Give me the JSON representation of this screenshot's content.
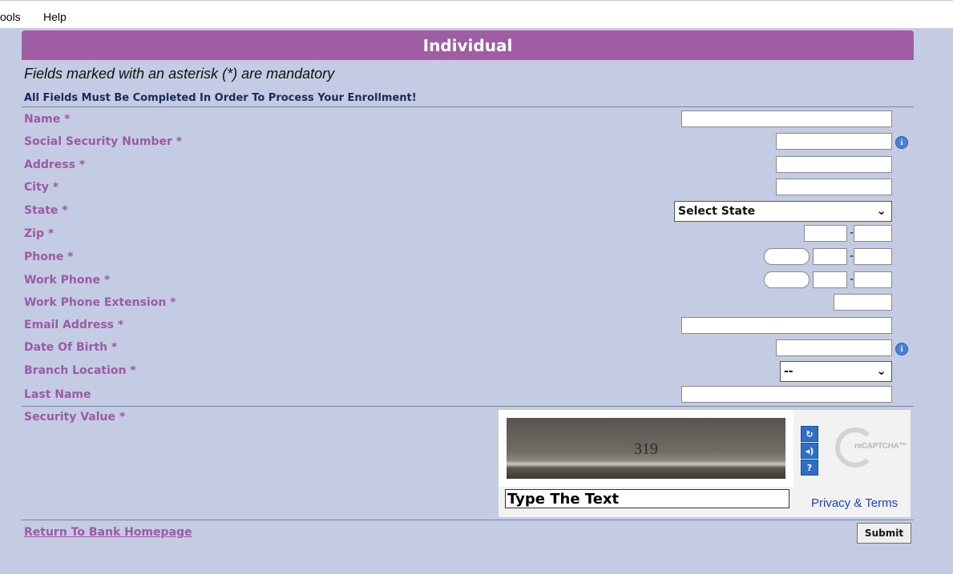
{
  "menu": {
    "tools": "ools",
    "help": "Help"
  },
  "form": {
    "title": "Individual",
    "mandatory_note": "Fields marked with an asterisk (*) are mandatory",
    "complete_note": "All Fields Must Be Completed In Order To Process Your Enrollment!",
    "labels": {
      "name": "Name *",
      "ssn": "Social Security Number *",
      "address": "Address *",
      "city": "City *",
      "state": "State *",
      "zip": "Zip *",
      "phone": "Phone *",
      "work_phone": "Work Phone *",
      "work_phone_ext": "Work Phone Extension *",
      "email": "Email Address *",
      "dob": "Date Of Birth *",
      "branch": "Branch Location *",
      "last_name": "Last Name",
      "security": "Security Value *"
    },
    "state_select": "Select State",
    "branch_select": "--",
    "dash": "-",
    "info_glyph": "i",
    "chevron_glyph": "⌄"
  },
  "captcha": {
    "image_text": "319",
    "input_value": "Type The Text",
    "privacy_terms": "Privacy & Terms",
    "logo_text": "reCAPTCHA™",
    "refresh_glyph": "↻",
    "audio_glyph": "◂)",
    "help_glyph": "?"
  },
  "footer": {
    "return_link": "Return To Bank Homepage",
    "submit": "Submit"
  }
}
